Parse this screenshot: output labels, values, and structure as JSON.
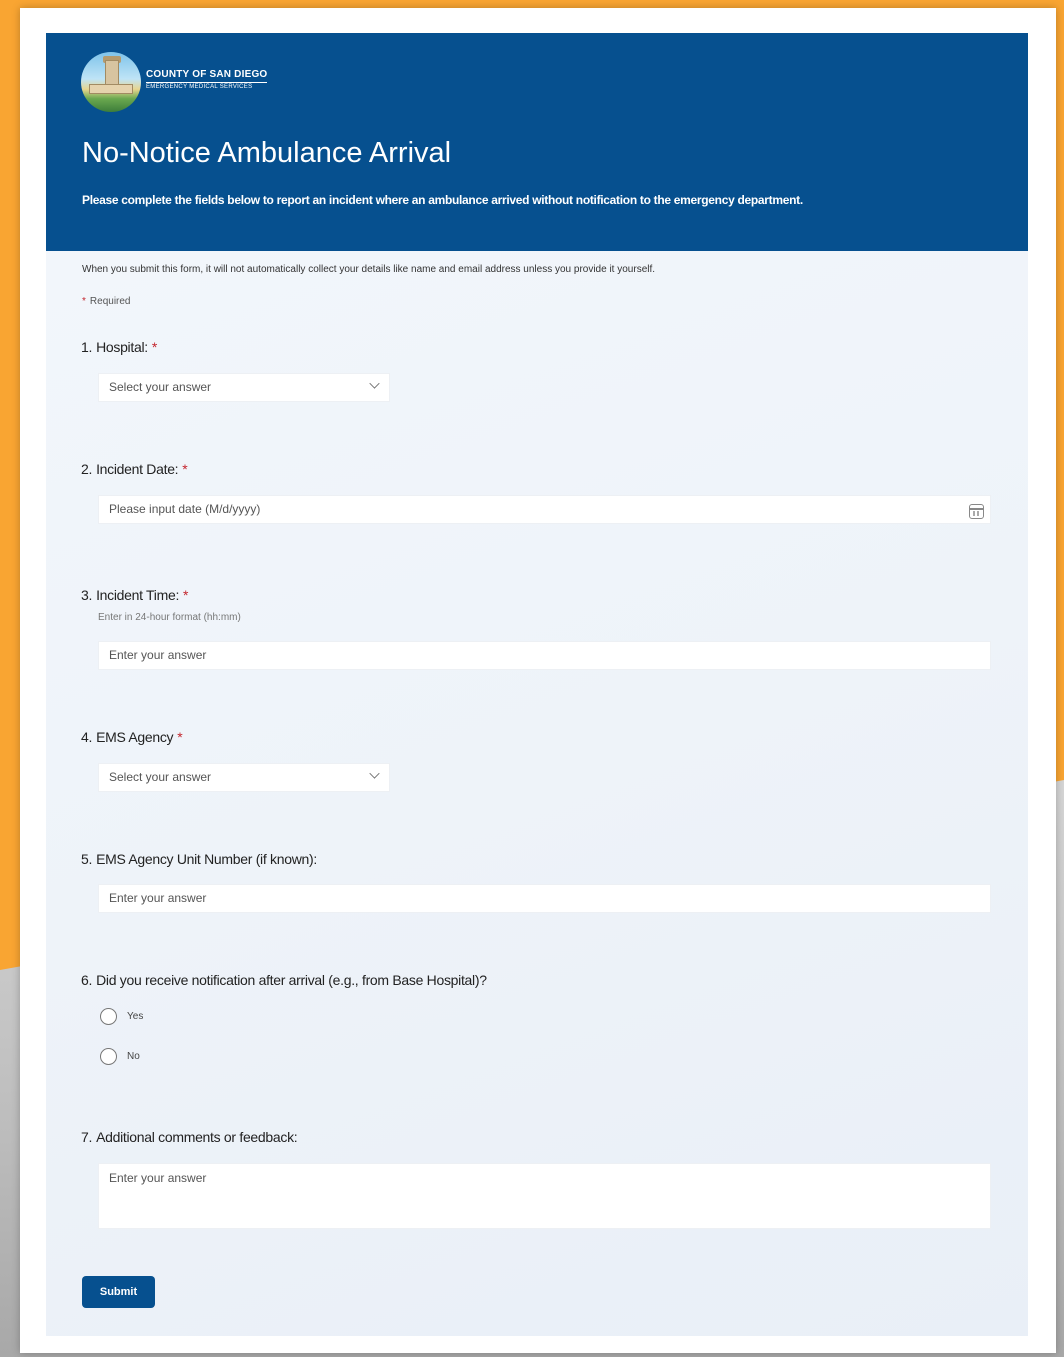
{
  "header": {
    "logo_line1": "COUNTY OF SAN DIEGO",
    "logo_line2": "EMERGENCY MEDICAL SERVICES",
    "title": "No-Notice Ambulance Arrival",
    "description": "Please complete the fields below to report an incident where an ambulance arrived without notification to the emergency department."
  },
  "privacy_notice": "When you submit this form, it will not automatically collect your details like name and email address unless you provide it yourself.",
  "required_label": "Required",
  "required_marker": "*",
  "questions": [
    {
      "number": "1.",
      "label": "Hospital:",
      "required": "*",
      "placeholder": "Select your answer"
    },
    {
      "number": "2.",
      "label": "Incident Date:",
      "required": "*",
      "placeholder": "Please input date (M/d/yyyy)"
    },
    {
      "number": "3.",
      "label": "Incident Time:",
      "required": "*",
      "subtitle": "Enter in 24-hour format (hh:mm)",
      "placeholder": "Enter your answer"
    },
    {
      "number": "4.",
      "label": "EMS Agency",
      "required": "*",
      "placeholder": "Select your answer"
    },
    {
      "number": "5.",
      "label": "EMS Agency Unit Number (if known):",
      "placeholder": "Enter your answer"
    },
    {
      "number": "6.",
      "label": "Did you receive notification after arrival (e.g., from Base Hospital)?",
      "options": [
        "Yes",
        "No"
      ]
    },
    {
      "number": "7.",
      "label": "Additional comments or feedback:",
      "placeholder": "Enter your answer"
    }
  ],
  "submit_label": "Submit",
  "colors": {
    "brand_blue": "#06508f",
    "required_red": "#c4262e",
    "frame_orange": "#f9a532"
  }
}
